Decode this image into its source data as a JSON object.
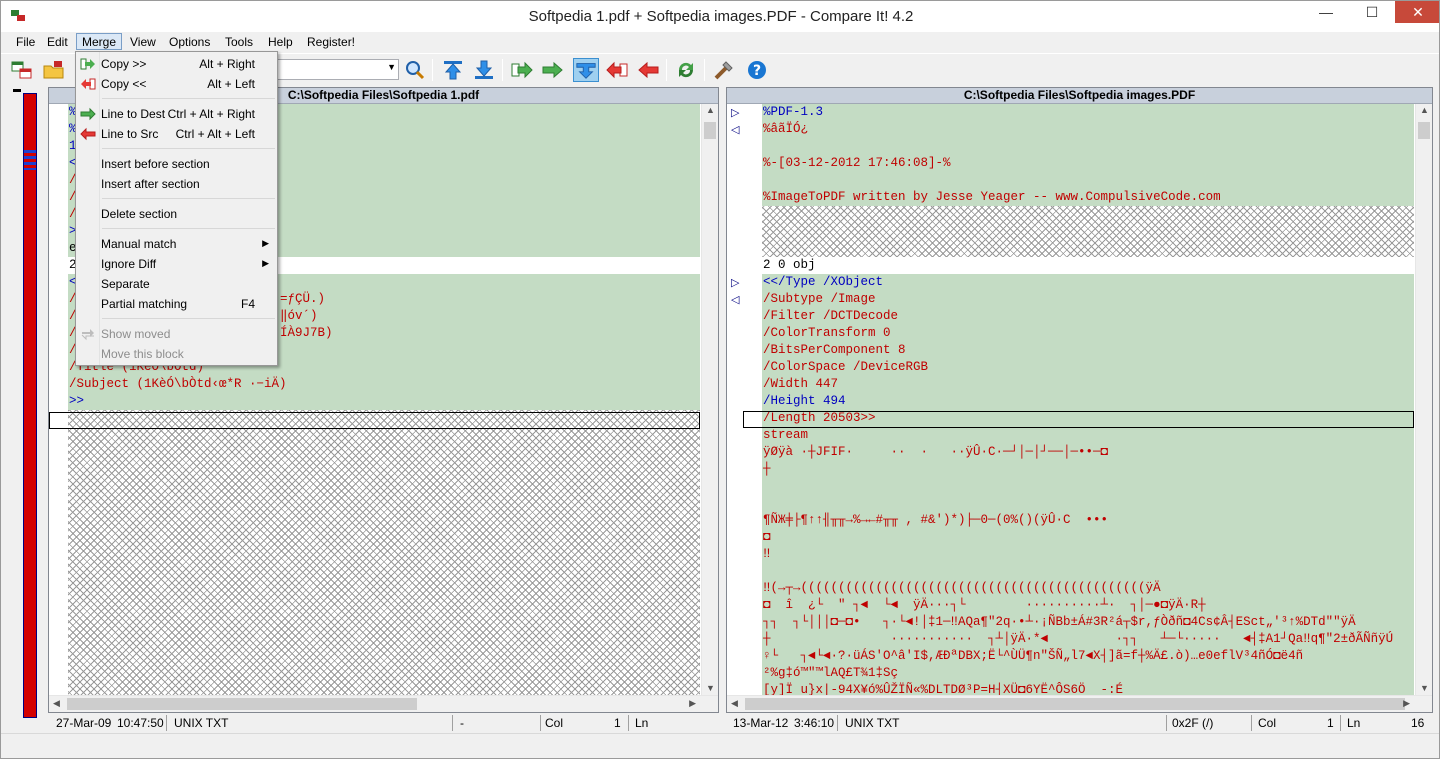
{
  "window": {
    "title": "Softpedia 1.pdf + Softpedia images.PDF - Compare It! 4.2",
    "minimize": "—",
    "maximize": "☐",
    "close": "✕"
  },
  "menubar": [
    "File",
    "Edit",
    "Merge",
    "View",
    "Options",
    "Tools",
    "Help",
    "Register!"
  ],
  "merge_menu": {
    "items": [
      {
        "label": "Copy >>",
        "shortcut": "Alt + Right"
      },
      {
        "label": "Copy <<",
        "shortcut": "Alt + Left"
      },
      {
        "label": "Line to Dest",
        "shortcut": "Ctrl + Alt + Right"
      },
      {
        "label": "Line to Src",
        "shortcut": "Ctrl + Alt + Left"
      },
      {
        "label": "Insert before section",
        "shortcut": ""
      },
      {
        "label": "Insert after section",
        "shortcut": ""
      },
      {
        "label": "Delete section",
        "shortcut": ""
      },
      {
        "label": "Manual match",
        "shortcut": ""
      },
      {
        "label": "Ignore Diff",
        "shortcut": ""
      },
      {
        "label": "Separate",
        "shortcut": ""
      },
      {
        "label": "Partial matching",
        "shortcut": "F4"
      },
      {
        "label": "Show moved",
        "shortcut": ""
      },
      {
        "label": "Move this block",
        "shortcut": ""
      }
    ]
  },
  "left_pane": {
    "header": "C:\\Softpedia Files\\Softpedia 1.pdf",
    "lines": [
      "%",
      "%",
      "1",
      "<",
      "/",
      "/",
      "/",
      ">",
      "e",
      "2",
      "",
      "<",
      "/",
      "/",
      "/",
      "/",
      "/Title (1KèÓ\\bÒtd)",
      "/Subject (1KèÓ\\bÒtd‹œ*R ·−iÄ)",
      ">>"
    ],
    "fragments": [
      "=ƒÇÜ.)",
      "‖óv´)",
      "ÍÀ9J7B)"
    ],
    "status": {
      "date": "27-Mar-09",
      "time": "10:47:50",
      "format": "UNIX TXT",
      "pos": "-",
      "col": "Col",
      "col_val": "1",
      "ln": "Ln"
    }
  },
  "right_pane": {
    "header": "C:\\Softpedia Files\\Softpedia images.PDF",
    "lines": [
      "%PDF-1.3",
      "%âãÏÓ¿",
      "",
      "%-[03-12-2012 17:46:08]-%",
      "",
      "%ImageToPDF written by Jesse Yeager -- www.CompulsiveCode.com",
      "2 0 obj",
      "<</Type /XObject",
      "/Subtype /Image",
      "/Filter /DCTDecode",
      "/ColorTransform 0",
      "/BitsPerComponent 8",
      "/ColorSpace /DeviceRGB",
      "/Width 447",
      "/Height 494",
      "/Length 20503>>",
      "stream",
      "ÿØÿà ·┼JFIF·     ··  ·   ··ÿÛ·C·─┘│─│┘──│─••─◘",
      "┼",
      "",
      "",
      "¶ÑЖ╪├¶↑↑╢╥╥→%→←#╥╥ , #&')*)├─0─(0%()(ÿÛ·C  •••",
      "◘",
      "‼",
      "",
      "‼(→┬→((((((((((((((((((((((((((((((((((((((((((((((ÿÄ",
      "◘  î  ¿└  \" ┐◄  └◄  ÿÄ···┐└        ··········┴·  ┐│─●◘ÿÄ·R┼",
      "┐┐  ┐└│││◘─◘•   ┐·└◄!│‡1─‼AQa¶\"2q·•┴·¡ÑBb±Á#3R²á┬$r,ƒÒðñ◘4Cs¢Â┤ESct„'³↑%DTd\"\"ÿÄ",
      "┼                ···········  ┐┴│ÿÄ·*◄         ·┐┐   ┴─└·····   ◄┤‡A1┘Qa‼q¶\"2±ðÃÑñÿÚ",
      "♀└   ┐◄└◄·?·üÁS'O^â'I$,ÆÐªDBX;Ë└^ÙÜ¶n\"ŠÑ„l7◄X┤]ã=f┼%Ä£.ò)…e0eflV³4ñÓ◘ë4ñ",
      "²%g‡ó™\"™lAQ£T¾1‡Sç",
      "[y]Ï u}x|-94X¥ó%ÛŽÏÑ«%DLTDØ³P=H┤XÜ◘6YË^ÔS6Ö  -:É"
    ],
    "status": {
      "date": "13-Mar-12",
      "time": "3:46:10",
      "format": "UNIX TXT",
      "offset": "0x2F (/)",
      "col": "Col",
      "col_val": "1",
      "ln": "Ln",
      "ln_val": "16"
    }
  },
  "colors": {
    "diff_bg": "#c4dcc4",
    "text_red": "#c00000",
    "text_blue": "#0000c0",
    "overview_bar": "#d40000",
    "header_bg": "#c8d0dc"
  },
  "icons": [
    "open-files-icon",
    "open-folder-icon",
    "search-icon",
    "prev-diff-icon",
    "next-diff-icon",
    "copy-right-icon",
    "copy-right-all-icon",
    "merge-down-icon",
    "copy-left-icon",
    "copy-left-all-icon",
    "refresh-icon",
    "tools-icon",
    "help-icon"
  ]
}
